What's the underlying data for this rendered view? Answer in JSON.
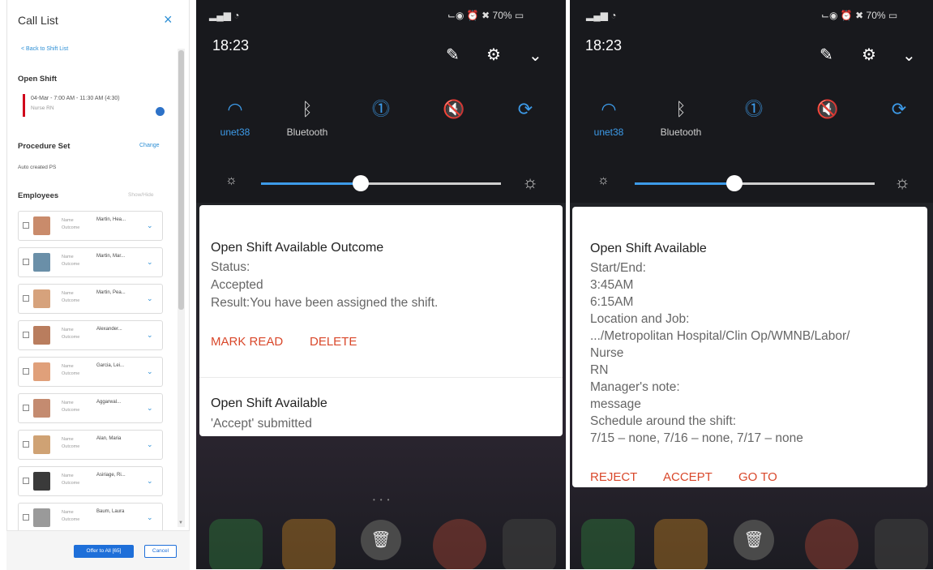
{
  "call_list": {
    "title": "Call List",
    "close_icon": "×",
    "back_link": "< Back to Shift List",
    "open_shift_heading": "Open Shift",
    "shift_time": "04-Mar - 7:00 AM - 11:30 AM (4:30)",
    "shift_role": "Nurse RN",
    "procedure_set_heading": "Procedure Set",
    "change_link": "Change",
    "procedure_value": "Auto created PS",
    "employees_heading": "Employees",
    "show_hide": "Show/Hide",
    "row_labels": [
      "Name",
      "Outcome"
    ],
    "employees": [
      {
        "name": "Martin, Hea..."
      },
      {
        "name": "Martin, Mar..."
      },
      {
        "name": "Martin, Pea..."
      },
      {
        "name": "Alexander..."
      },
      {
        "name": "Garcia, Lei..."
      },
      {
        "name": "Aggarwal..."
      },
      {
        "name": "Alan, Maria"
      },
      {
        "name": "Asiriage, Ri..."
      },
      {
        "name": "Baum, Laura"
      }
    ],
    "offer_button": "Offer to All [65]",
    "cancel_button": "Cancel"
  },
  "phone1": {
    "signal": "▂▄▆ ◔",
    "status_right": "⌙◉ ⏰ ✖ 70% ▭",
    "time": "18:23",
    "wifi_label": "unet38",
    "bluetooth_label": "Bluetooth",
    "notification": {
      "title": "Open Shift Available Outcome",
      "lines": [
        "Status:",
        "Accepted",
        "Result:You have been assigned the shift."
      ],
      "actions": [
        "MARK READ",
        "DELETE"
      ]
    },
    "notification2": {
      "title": "Open Shift Available",
      "line": "'Accept' submitted"
    }
  },
  "phone2": {
    "signal": "▂▄▆ ◔",
    "status_right": "⌙◉ ⏰ ✖ 70% ▭",
    "time": "18:23",
    "wifi_label": "unet38",
    "bluetooth_label": "Bluetooth",
    "notification": {
      "title": "Open Shift Available",
      "lines": [
        "Start/End:",
        "3:45AM",
        "6:15AM",
        "Location and Job:",
        ".../Metropolitan Hospital/Clin Op/WMNB/Labor/",
        "Nurse",
        "RN",
        "Manager's note:",
        "message",
        "Schedule around the shift:",
        "7/15 – none, 7/16 – none, 7/17 – none"
      ],
      "actions": [
        "REJECT",
        "ACCEPT",
        "GO TO"
      ]
    }
  },
  "colors": {
    "accent_blue": "#2d8fd5",
    "action_red": "#d9482b",
    "shift_bar_red": "#d0021b",
    "phone_bg": "#18191d"
  },
  "brightness_level_percent": [
    41,
    41
  ]
}
